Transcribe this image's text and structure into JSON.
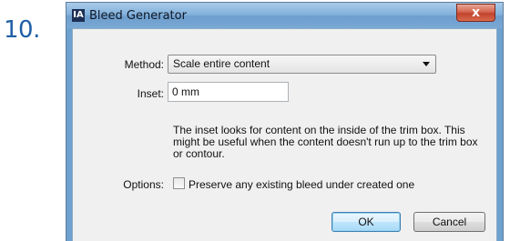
{
  "step": {
    "number": "10."
  },
  "window": {
    "title": "Bleed Generator",
    "icon_text": "IA",
    "close_glyph": "x"
  },
  "form": {
    "method": {
      "label": "Method:",
      "value": "Scale entire content"
    },
    "inset": {
      "label": "Inset:",
      "value": "0 mm"
    },
    "help_text": "The inset looks for content on the inside of the trim box. This might be useful when the content doesn't run up to the trim box or contour.",
    "options": {
      "label": "Options:",
      "checkbox_label": "Preserve any existing bleed under created one",
      "checked": false
    }
  },
  "buttons": {
    "ok": "OK",
    "cancel": "Cancel"
  },
  "colors": {
    "step_number": "#1f5fa6",
    "titlebar": "#84b2dc",
    "close_button": "#c1432c",
    "dialog_background": "#f0f0f0",
    "default_button_border": "#3c7fb1"
  }
}
